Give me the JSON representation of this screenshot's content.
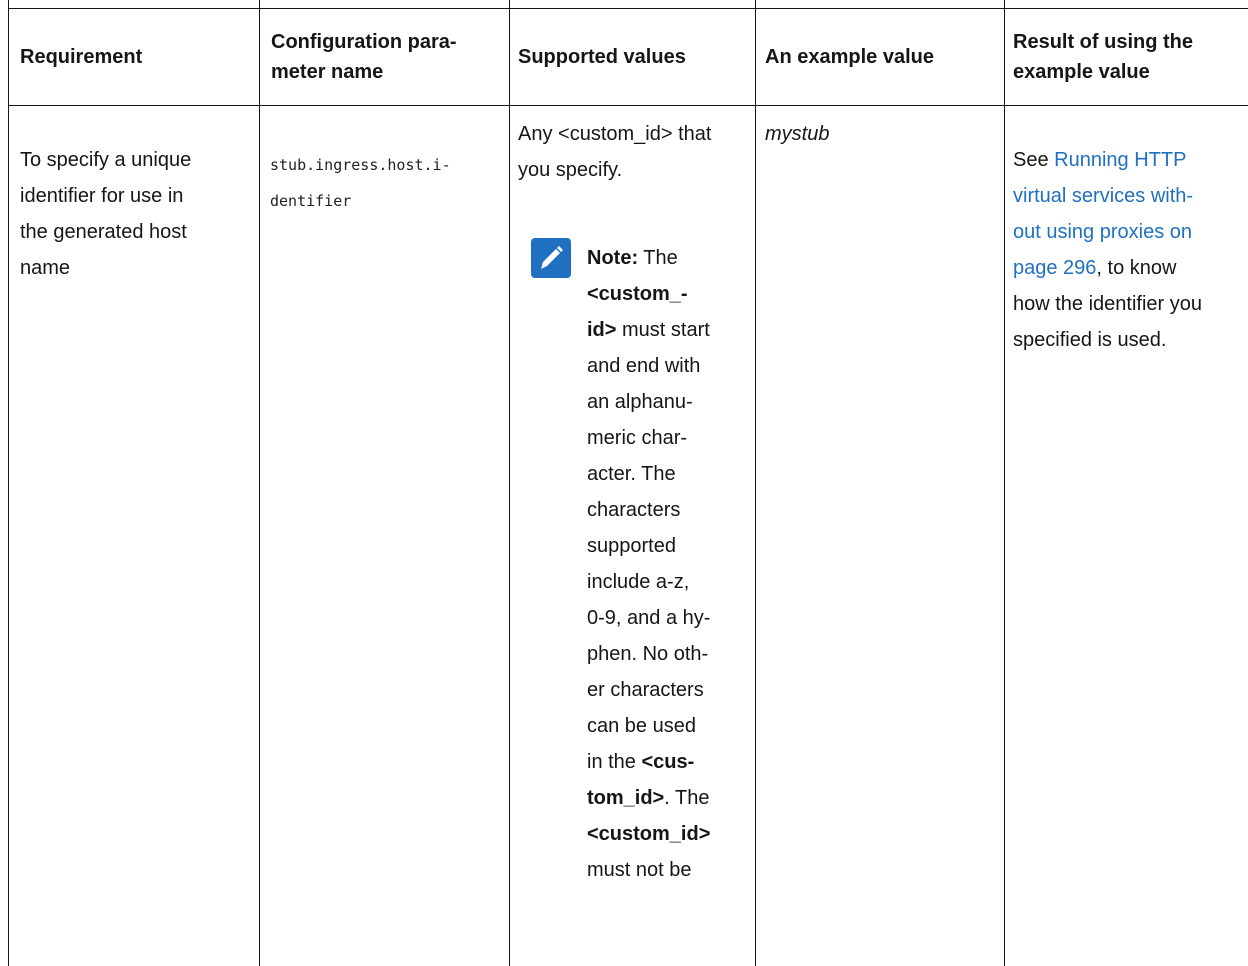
{
  "table": {
    "headers": [
      "Requirement",
      [
        "Configuration para-",
        "meter name"
      ],
      "Supported values",
      "An example value",
      [
        "Result of using the",
        "example value"
      ]
    ],
    "row": {
      "requirement": [
        "To specify a unique",
        "identifier for use in",
        "the generated host",
        "name"
      ],
      "parameter": [
        "stub.ingress.host.i-",
        "dentifier"
      ],
      "supported": [
        "Any <custom_id> that",
        "you specify."
      ],
      "example": "mystub",
      "result": {
        "prefix": "See ",
        "link_lines": [
          "Running HTTP",
          "virtual services with-",
          "out using proxies on",
          "page 296"
        ],
        "after_link": ", to know",
        "rest": [
          "how the identifier you",
          "specified is used."
        ]
      }
    },
    "note": {
      "icon": "pencil-icon",
      "icon_color": "#1f70c1",
      "label": "Note:",
      "lines": [
        [
          {
            "t": "Note:",
            "b": true
          },
          {
            "t": " The"
          }
        ],
        [
          {
            "t": "<custom_-",
            "b": true
          }
        ],
        [
          {
            "t": "id>",
            "b": true
          },
          {
            "t": " must start"
          }
        ],
        [
          {
            "t": "and end with"
          }
        ],
        [
          {
            "t": "an alphanu-"
          }
        ],
        [
          {
            "t": "meric char-"
          }
        ],
        [
          {
            "t": "acter. The"
          }
        ],
        [
          {
            "t": "characters"
          }
        ],
        [
          {
            "t": "supported"
          }
        ],
        [
          {
            "t": "include a-z,"
          }
        ],
        [
          {
            "t": "0-9, and a hy-"
          }
        ],
        [
          {
            "t": "phen. No oth-"
          }
        ],
        [
          {
            "t": "er characters"
          }
        ],
        [
          {
            "t": "can be used"
          }
        ],
        [
          {
            "t": "in the "
          },
          {
            "t": "<cus-",
            "b": true
          }
        ],
        [
          {
            "t": "tom_id>",
            "b": true
          },
          {
            "t": ". The"
          }
        ],
        [
          {
            "t": "<custom_id>",
            "b": true
          }
        ],
        [
          {
            "t": "must not be"
          }
        ]
      ]
    }
  }
}
